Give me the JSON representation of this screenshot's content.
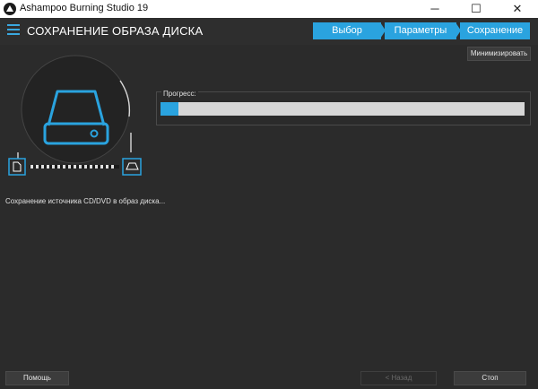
{
  "window": {
    "title": "Ashampoo Burning Studio 19",
    "min_icon": "minimize-icon",
    "max_icon": "maximize-icon",
    "close_icon": "close-icon"
  },
  "header": {
    "title": "СОХРАНЕНИЕ ОБРАЗА ДИСКА",
    "menu_icon": "hamburger-menu-icon"
  },
  "steps": [
    "Выбор",
    "Параметры",
    "Сохранение"
  ],
  "toolbar": {
    "minimize_label": "Минимизировать"
  },
  "progress": {
    "label": "Прогресс:",
    "value": 0.05
  },
  "status_text": "Сохранение источника CD/DVD в образ диска...",
  "illustration": {
    "icons": [
      "hard-drive-icon",
      "document-icon",
      "disc-drive-icon"
    ]
  },
  "footer": {
    "help_label": "Помощь",
    "back_label": "< Назад",
    "stop_label": "Стоп"
  },
  "colors": {
    "accent": "#2aa3df",
    "background": "#2b2b2b",
    "titlebar": "#ffffff"
  }
}
